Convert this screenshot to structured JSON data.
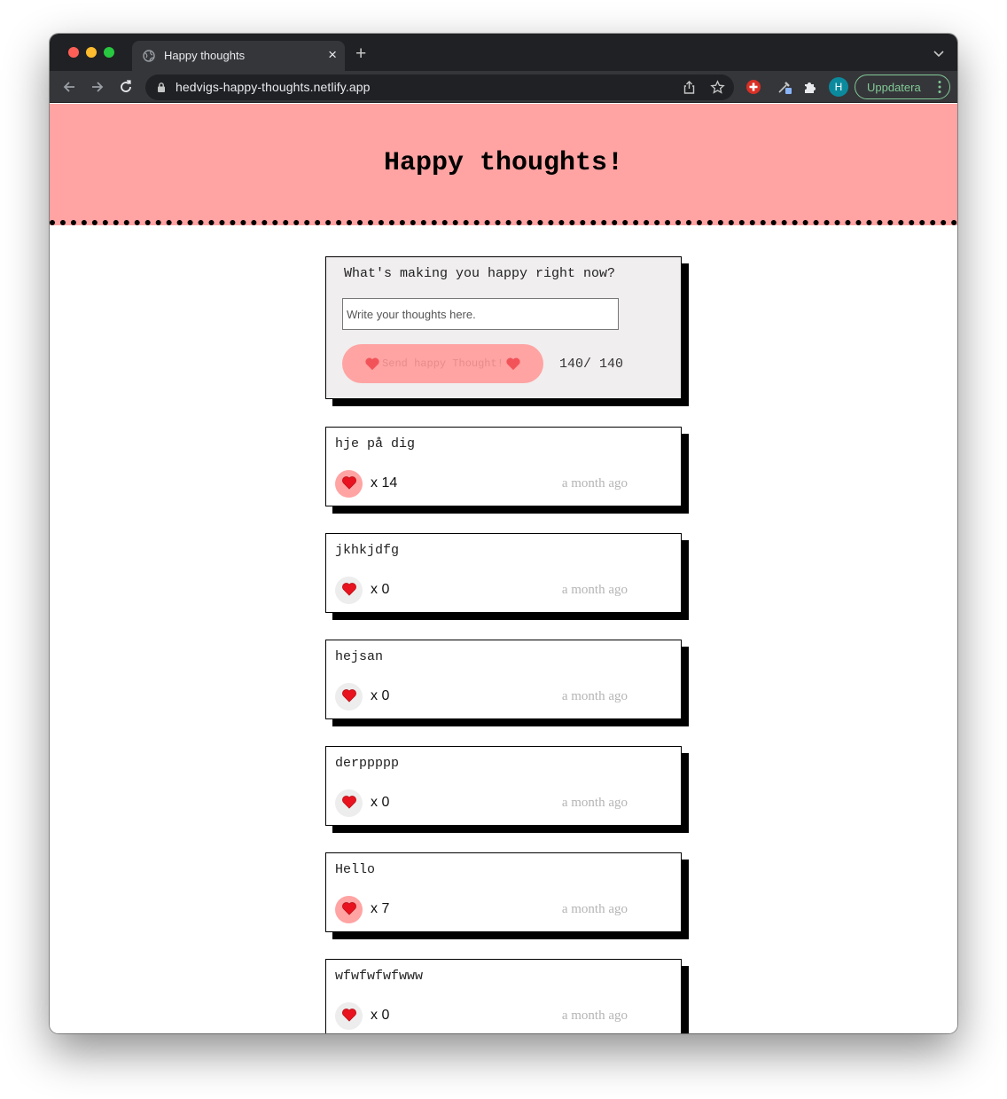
{
  "browser": {
    "tab_title": "Happy thoughts",
    "url": "hedvigs-happy-thoughts.netlify.app",
    "avatar_letter": "H",
    "update_label": "Uppdatera"
  },
  "header": {
    "title": "Happy thoughts!"
  },
  "form": {
    "prompt": "What's making you happy right now?",
    "placeholder": "Write your thoughts here.",
    "send_label": "Send happy Thought!",
    "char_count": "140/ 140"
  },
  "colors": {
    "header_bg": "#ffa3a3",
    "form_bg": "#f0eeee",
    "liked": "#ffa3a3",
    "unliked": "#ededed"
  },
  "thoughts": [
    {
      "text": "hje på dig",
      "likes": "x 14",
      "time": "a month ago",
      "liked": true
    },
    {
      "text": "jkhkjdfg",
      "likes": "x 0",
      "time": "a month ago",
      "liked": false
    },
    {
      "text": "hejsan",
      "likes": "x 0",
      "time": "a month ago",
      "liked": false
    },
    {
      "text": "derppppp",
      "likes": "x 0",
      "time": "a month ago",
      "liked": false
    },
    {
      "text": "Hello",
      "likes": "x 7",
      "time": "a month ago",
      "liked": true
    },
    {
      "text": "wfwfwfwfwww",
      "likes": "x 0",
      "time": "a month ago",
      "liked": false
    }
  ]
}
